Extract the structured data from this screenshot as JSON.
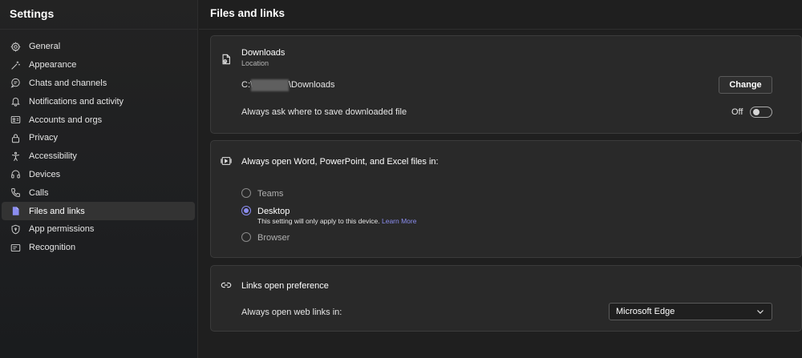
{
  "sidebar": {
    "title": "Settings",
    "items": [
      {
        "label": "General",
        "icon": "gear-icon"
      },
      {
        "label": "Appearance",
        "icon": "magic-wand-icon"
      },
      {
        "label": "Chats and channels",
        "icon": "chat-bubble-icon"
      },
      {
        "label": "Notifications and activity",
        "icon": "bell-icon"
      },
      {
        "label": "Accounts and orgs",
        "icon": "id-card-icon"
      },
      {
        "label": "Privacy",
        "icon": "lock-icon"
      },
      {
        "label": "Accessibility",
        "icon": "accessibility-icon"
      },
      {
        "label": "Devices",
        "icon": "headset-icon"
      },
      {
        "label": "Calls",
        "icon": "phone-icon"
      },
      {
        "label": "Files and links",
        "icon": "document-icon",
        "active": true
      },
      {
        "label": "App permissions",
        "icon": "shield-icon"
      },
      {
        "label": "Recognition",
        "icon": "recognition-icon"
      }
    ]
  },
  "main": {
    "title": "Files and links",
    "downloads": {
      "heading": "Downloads",
      "subheading": "Location",
      "path_prefix": "C:\\",
      "path_suffix": "\\Downloads",
      "change_label": "Change",
      "ask_label": "Always ask where to save downloaded file",
      "toggle_state": "Off"
    },
    "open_files": {
      "heading": "Always open Word, PowerPoint, and Excel files in:",
      "options": [
        {
          "label": "Teams",
          "checked": false
        },
        {
          "label": "Desktop",
          "checked": true,
          "note": "This setting will only apply to this device.",
          "link": "Learn More"
        },
        {
          "label": "Browser",
          "checked": false
        }
      ]
    },
    "links": {
      "heading": "Links open preference",
      "label": "Always open web links in:",
      "selected": "Microsoft Edge"
    }
  },
  "colors": {
    "accent": "#8b8df0",
    "background": "#1f1f1f",
    "card": "#292929"
  }
}
